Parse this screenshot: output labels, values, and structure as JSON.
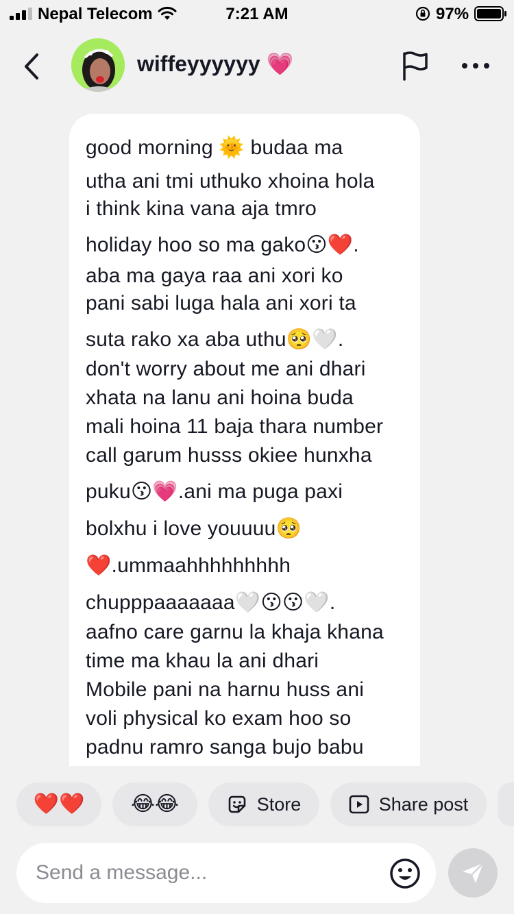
{
  "status_bar": {
    "carrier": "Nepal Telecom",
    "time": "7:21 AM",
    "battery": "97%",
    "icons": [
      "signal-icon",
      "wifi-icon",
      "orientation-lock-icon",
      "battery-icon"
    ]
  },
  "header": {
    "title": "wiffeyyyyyy 💗",
    "icons": [
      "back-icon",
      "flag-icon",
      "more-icon"
    ]
  },
  "message": {
    "lines": [
      "good morning 🌞 budaa ma",
      "utha ani tmi uthuko xhoina hola",
      "i think kina vana aja tmro",
      "holiday hoo so ma gako😗❤️.",
      "aba ma gaya raa ani xori ko",
      "pani sabi luga hala ani xori ta",
      "suta rako xa aba uthu🥺🤍.",
      "don't worry about me ani dhari",
      "xhata na lanu ani hoina buda",
      "mali hoina 11 baja thara number",
      "call garum husss okiee hunxha",
      "puku😗💗.ani ma puga paxi",
      "bolxhu i love youuuu🥺",
      "❤️.ummaahhhhhhhhh",
      "chupppaaaaaaa🤍😗😗🤍.",
      "aafno care garnu la khaja khana",
      "time ma khau la ani dhari",
      "Mobile pani na harnu huss ani",
      "voli physical ko exam hoo so",
      "padnu ramro sanga bujo babu"
    ]
  },
  "quick_actions": [
    {
      "label": "❤️❤️"
    },
    {
      "label": "😂😂"
    },
    {
      "label": "Store",
      "icon": "sticker-icon"
    },
    {
      "label": "Share post",
      "icon": "play-icon"
    }
  ],
  "composer": {
    "placeholder": "Send a message...",
    "value": ""
  },
  "colors": {
    "background": "#f1f1f2",
    "bubble": "#ffffff",
    "chip": "#e7e7e9",
    "send_button": "#d4d4d7",
    "avatar_bg": "#9be456"
  }
}
